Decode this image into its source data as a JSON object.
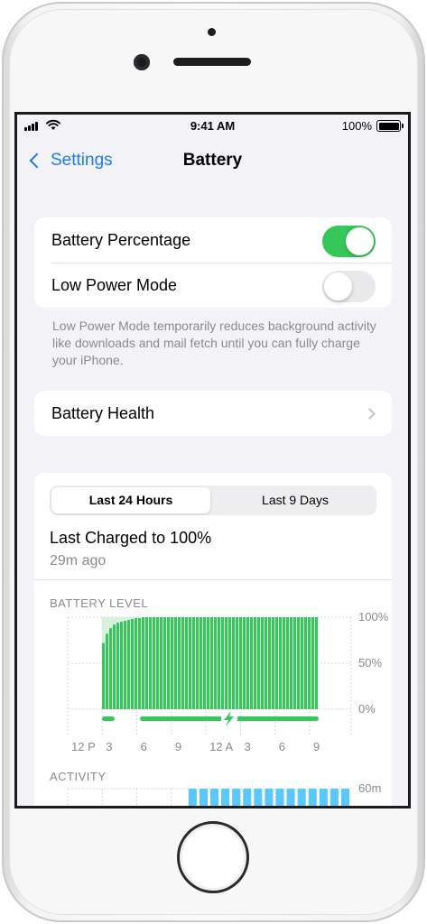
{
  "status_bar": {
    "time": "9:41 AM",
    "battery_percent": "100%"
  },
  "nav": {
    "back_label": "Settings",
    "title": "Battery"
  },
  "settings": {
    "battery_percentage": {
      "label": "Battery Percentage",
      "enabled": true
    },
    "low_power_mode": {
      "label": "Low Power Mode",
      "enabled": false
    },
    "footnote": "Low Power Mode temporarily reduces background activity like downloads and mail fetch until you can fully charge your iPhone.",
    "battery_health_label": "Battery Health"
  },
  "usage": {
    "segments": [
      "Last 24 Hours",
      "Last 9 Days"
    ],
    "selected_segment": "Last 24 Hours",
    "last_charged_title": "Last Charged to 100%",
    "last_charged_subtitle": "29m ago"
  },
  "colors": {
    "accent": "#1a7cf5",
    "toggle_on": "#35c759",
    "battery_bar": "#35c759",
    "activity_bar": "#5ac8fa"
  },
  "chart_data": [
    {
      "type": "bar",
      "title": "BATTERY LEVEL",
      "y_tick_labels": [
        "100%",
        "50%",
        "0%"
      ],
      "ylim": [
        0,
        100
      ],
      "x_tick_labels": [
        "12 P",
        "3",
        "6",
        "9",
        "12 A",
        "3",
        "6",
        "9"
      ],
      "values": [
        72,
        82,
        88,
        92,
        94,
        95,
        96,
        97,
        98,
        99,
        99,
        100,
        100,
        100,
        100,
        100,
        100,
        100,
        100,
        100,
        100,
        100,
        100,
        100,
        100,
        100,
        100,
        100,
        100,
        100,
        100,
        100,
        100,
        100,
        100,
        100,
        100,
        100,
        100,
        100,
        100,
        100,
        100,
        100,
        100,
        100,
        100,
        100,
        100,
        100,
        100,
        100,
        100,
        100,
        100,
        100,
        100,
        100,
        100,
        100
      ],
      "charging_icon": "lightning-bolt-icon"
    },
    {
      "type": "bar",
      "title": "ACTIVITY",
      "y_tick_labels": [
        "60m"
      ],
      "ylim": [
        0,
        60
      ],
      "values": [
        0,
        0,
        0,
        0,
        0,
        0,
        0,
        0,
        0,
        0,
        10,
        60,
        60,
        60,
        60,
        60,
        60,
        60,
        60,
        60,
        60,
        60,
        60,
        60,
        60,
        60
      ]
    }
  ]
}
